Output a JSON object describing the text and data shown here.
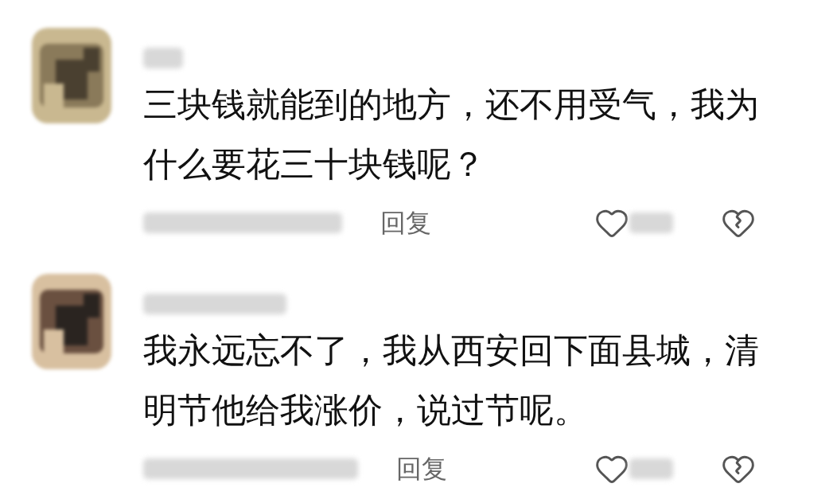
{
  "comments": [
    {
      "text": "三块钱就能到的地方，还不用受气，我为什么要花三十块钱呢？",
      "reply": "回复"
    },
    {
      "text": "我永远忘不了，我从西安回下面县城，清明节他给我涨价，说过节呢。",
      "reply": "回复"
    }
  ]
}
